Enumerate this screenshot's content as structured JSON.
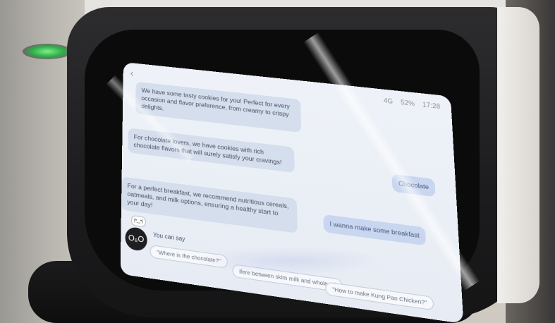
{
  "screen": {
    "status": {
      "time": "17:28",
      "battery": "52%",
      "signal": "4G"
    },
    "messages": [
      {
        "role": "bot",
        "text": "We have some tasty cookies for you! Perfect for every occasion and flavor preference, from creamy to crispy delights."
      },
      {
        "role": "bot",
        "text": "For chocolate lovers, we have cookies with rich chocolate flavors that will surely satisfy your cravings!"
      },
      {
        "role": "user",
        "text": "Chocolate"
      },
      {
        "role": "bot",
        "text": "For a perfect breakfast, we recommend nutritious cereals, oatmeals, and milk options, ensuring a healthy start to your day!"
      },
      {
        "role": "user",
        "text": "I wanna make some breakfast"
      }
    ],
    "assistant": {
      "avatar_text": "O₆O",
      "mini_text": "(•‿•)",
      "you_can_say": "You can say"
    },
    "suggestions": [
      "\"Where is the chocolate?\"",
      "ifere between skim milk and whole mi",
      "\"How to make Kung Pao Chicken?\""
    ]
  }
}
